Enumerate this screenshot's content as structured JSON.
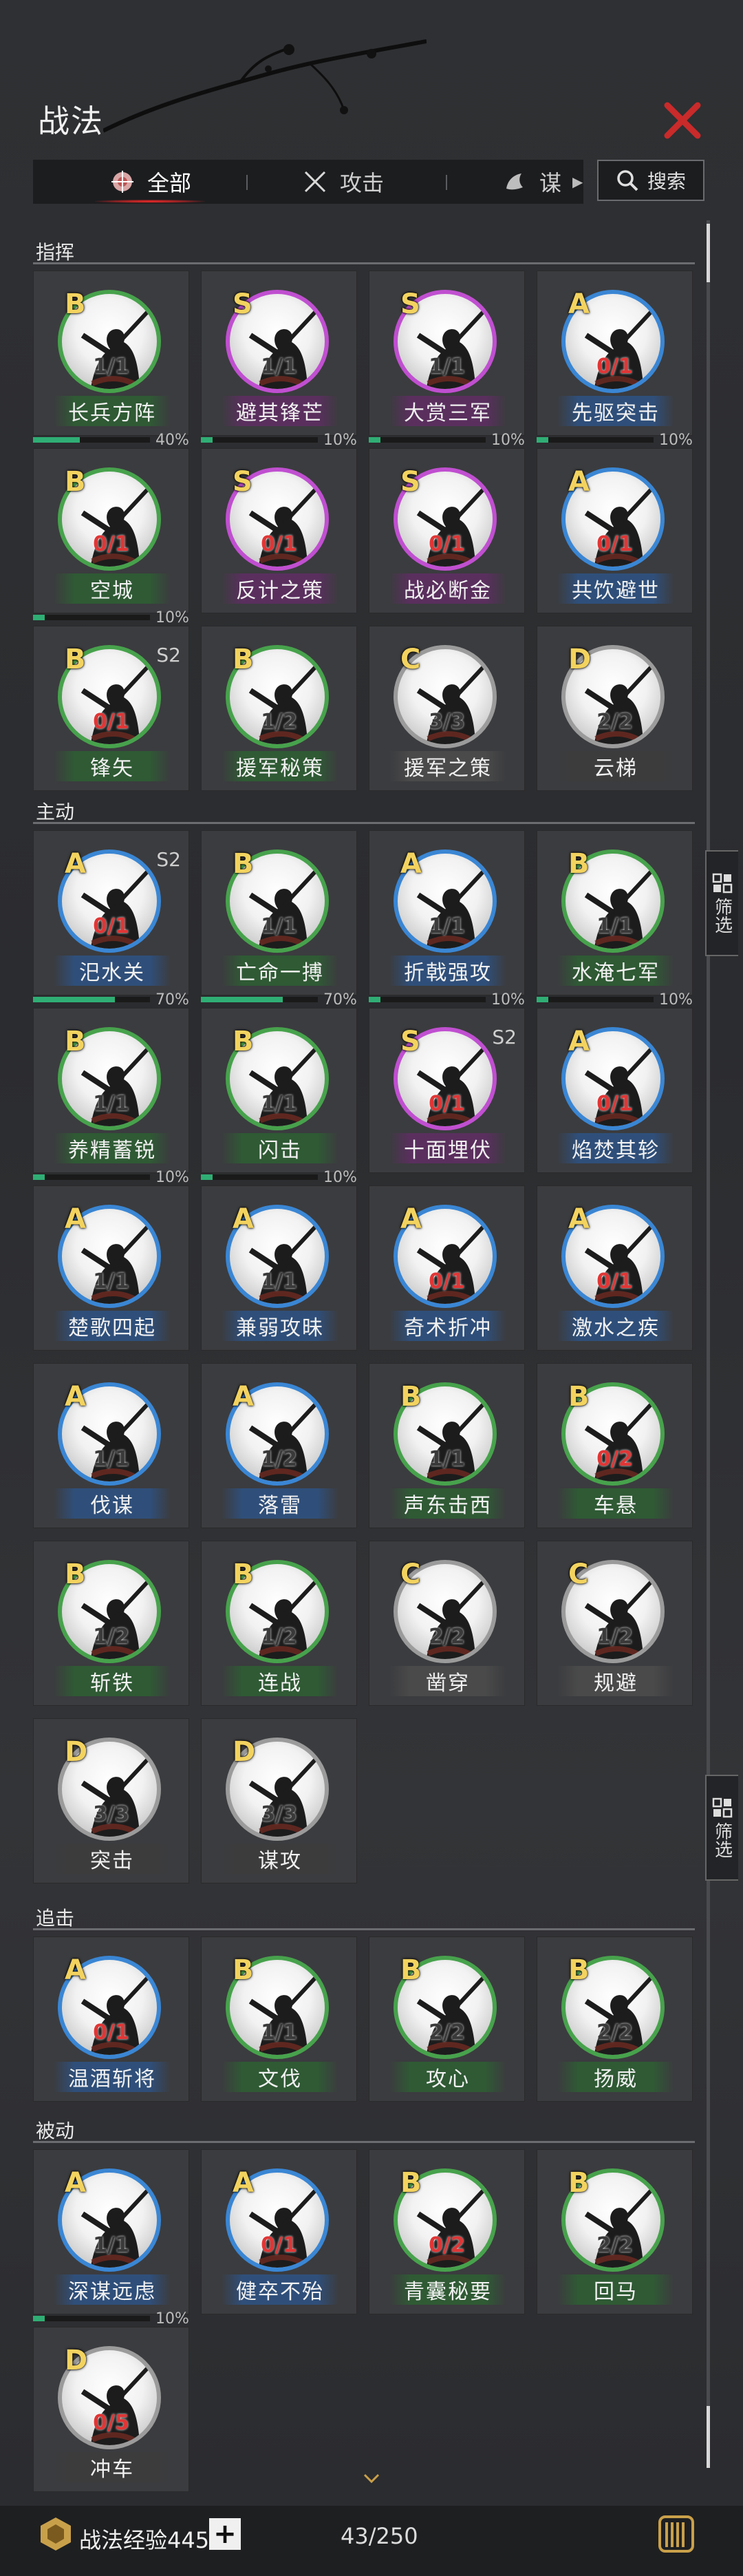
{
  "colors": {
    "A": "#3a86d4",
    "B": "#47a24c",
    "C": "#9b9b9b",
    "D": "#9b9b9b",
    "S": "#c04fd0",
    "nameA": "#2f4f7a",
    "nameB": "#2f5a34",
    "nameS": "#5a2f5e",
    "nameC": "#4a4a4a",
    "nameD": "#3c3c3c"
  },
  "header": {
    "title": "战法",
    "close_icon": "close-x-icon"
  },
  "tabs": [
    {
      "label": "全部",
      "icon": "all-crest-icon"
    },
    {
      "label": "攻击",
      "icon": "crossed-swords-icon"
    },
    {
      "label": "谋",
      "icon": "scroll-icon"
    }
  ],
  "search": {
    "label": "搜索",
    "icon": "search-icon"
  },
  "filter": {
    "label": "筛选"
  },
  "sections": [
    {
      "title": "指挥",
      "cards": [
        {
          "grade": "B",
          "count": "1/1",
          "red": false,
          "name": "长兵方阵",
          "pct": 40,
          "pct_text": "40%"
        },
        {
          "grade": "S",
          "count": "1/1",
          "red": false,
          "name": "避其锋芒",
          "pct": 10,
          "pct_text": "10%"
        },
        {
          "grade": "S",
          "count": "1/1",
          "red": false,
          "name": "大赏三军",
          "pct": 10,
          "pct_text": "10%"
        },
        {
          "grade": "A",
          "count": "0/1",
          "red": true,
          "name": "先驱突击",
          "pct": 10,
          "pct_text": "10%"
        },
        {
          "grade": "B",
          "count": "0/1",
          "red": true,
          "name": "空城",
          "pct": 10,
          "pct_text": "10%"
        },
        {
          "grade": "S",
          "count": "0/1",
          "red": true,
          "name": "反计之策"
        },
        {
          "grade": "S",
          "count": "0/1",
          "red": true,
          "name": "战必断金"
        },
        {
          "grade": "A",
          "count": "0/1",
          "red": true,
          "name": "共饮避世"
        },
        {
          "grade": "B",
          "count": "0/1",
          "red": true,
          "name": "锋矢",
          "season": "S2"
        },
        {
          "grade": "B",
          "count": "1/2",
          "red": false,
          "name": "援军秘策"
        },
        {
          "grade": "C",
          "count": "3/3",
          "red": false,
          "name": "援军之策"
        },
        {
          "grade": "D",
          "count": "2/2",
          "red": false,
          "name": "云梯"
        }
      ]
    },
    {
      "title": "主动",
      "cards": [
        {
          "grade": "A",
          "count": "0/1",
          "red": true,
          "name": "汜水关",
          "season": "S2",
          "pct": 70,
          "pct_text": "70%"
        },
        {
          "grade": "B",
          "count": "1/1",
          "red": false,
          "name": "亡命一搏",
          "pct": 70,
          "pct_text": "70%"
        },
        {
          "grade": "A",
          "count": "1/1",
          "red": false,
          "name": "折戟强攻",
          "pct": 10,
          "pct_text": "10%"
        },
        {
          "grade": "B",
          "count": "1/1",
          "red": false,
          "name": "水淹七军",
          "pct": 10,
          "pct_text": "10%"
        },
        {
          "grade": "B",
          "count": "1/1",
          "red": false,
          "name": "养精蓄锐",
          "pct": 10,
          "pct_text": "10%"
        },
        {
          "grade": "B",
          "count": "1/1",
          "red": false,
          "name": "闪击",
          "pct": 10,
          "pct_text": "10%"
        },
        {
          "grade": "S",
          "count": "0/1",
          "red": true,
          "name": "十面埋伏",
          "season": "S2"
        },
        {
          "grade": "A",
          "count": "0/1",
          "red": true,
          "name": "焰焚其轸"
        },
        {
          "grade": "A",
          "count": "1/1",
          "red": false,
          "name": "楚歌四起"
        },
        {
          "grade": "A",
          "count": "1/1",
          "red": false,
          "name": "兼弱攻昧"
        },
        {
          "grade": "A",
          "count": "0/1",
          "red": true,
          "name": "奇术折冲"
        },
        {
          "grade": "A",
          "count": "0/1",
          "red": true,
          "name": "激水之疾"
        },
        {
          "grade": "A",
          "count": "1/1",
          "red": false,
          "name": "伐谋"
        },
        {
          "grade": "A",
          "count": "1/2",
          "red": false,
          "name": "落雷"
        },
        {
          "grade": "B",
          "count": "1/1",
          "red": false,
          "name": "声东击西"
        },
        {
          "grade": "B",
          "count": "0/2",
          "red": true,
          "name": "车悬"
        },
        {
          "grade": "B",
          "count": "1/2",
          "red": false,
          "name": "斩铁"
        },
        {
          "grade": "B",
          "count": "1/2",
          "red": false,
          "name": "连战"
        },
        {
          "grade": "C",
          "count": "2/2",
          "red": false,
          "name": "凿穿"
        },
        {
          "grade": "C",
          "count": "1/2",
          "red": false,
          "name": "规避"
        },
        {
          "grade": "D",
          "count": "3/3",
          "red": false,
          "name": "突击"
        },
        {
          "grade": "D",
          "count": "3/3",
          "red": false,
          "name": "谋攻"
        }
      ]
    },
    {
      "title": "追击",
      "cards": [
        {
          "grade": "A",
          "count": "0/1",
          "red": true,
          "name": "温酒斩将"
        },
        {
          "grade": "B",
          "count": "1/1",
          "red": false,
          "name": "文伐"
        },
        {
          "grade": "B",
          "count": "2/2",
          "red": false,
          "name": "攻心"
        },
        {
          "grade": "B",
          "count": "2/2",
          "red": false,
          "name": "扬威"
        }
      ]
    },
    {
      "title": "被动",
      "cards": [
        {
          "grade": "A",
          "count": "1/1",
          "red": false,
          "name": "深谋远虑",
          "pct": 10,
          "pct_text": "10%"
        },
        {
          "grade": "A",
          "count": "0/1",
          "red": true,
          "name": "健卒不殆"
        },
        {
          "grade": "B",
          "count": "0/2",
          "red": true,
          "name": "青囊秘要"
        },
        {
          "grade": "B",
          "count": "2/2",
          "red": false,
          "name": "回马"
        },
        {
          "grade": "D",
          "count": "0/5",
          "red": true,
          "name": "冲车"
        }
      ]
    }
  ],
  "footer": {
    "exp_label": "战法经验445",
    "plus": "+",
    "count": "43/250"
  }
}
